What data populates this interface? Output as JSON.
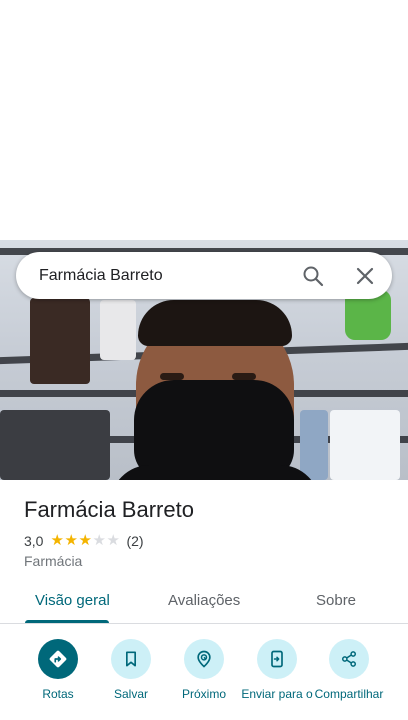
{
  "search": {
    "query": "Farmácia Barreto",
    "search_icon": "search-icon",
    "close_icon": "close-icon"
  },
  "place": {
    "name": "Farmácia Barreto",
    "rating_text": "3,0",
    "rating_value": 3,
    "rating_max": 5,
    "review_count": "(2)",
    "category": "Farmácia"
  },
  "tabs": [
    {
      "label": "Visão geral",
      "active": true
    },
    {
      "label": "Avaliações",
      "active": false
    },
    {
      "label": "Sobre",
      "active": false
    }
  ],
  "actions": [
    {
      "label": "Rotas",
      "icon": "directions-icon"
    },
    {
      "label": "Salvar",
      "icon": "bookmark-icon"
    },
    {
      "label": "Próximo",
      "icon": "nearby-icon"
    },
    {
      "label": "Enviar para o",
      "icon": "send-to-phone-icon"
    },
    {
      "label": "Compartilhar",
      "icon": "share-icon"
    }
  ],
  "colors": {
    "accent": "#00687a",
    "accent_light": "#cdf0f7",
    "star": "#f4b400",
    "star_empty": "#dadce0"
  }
}
